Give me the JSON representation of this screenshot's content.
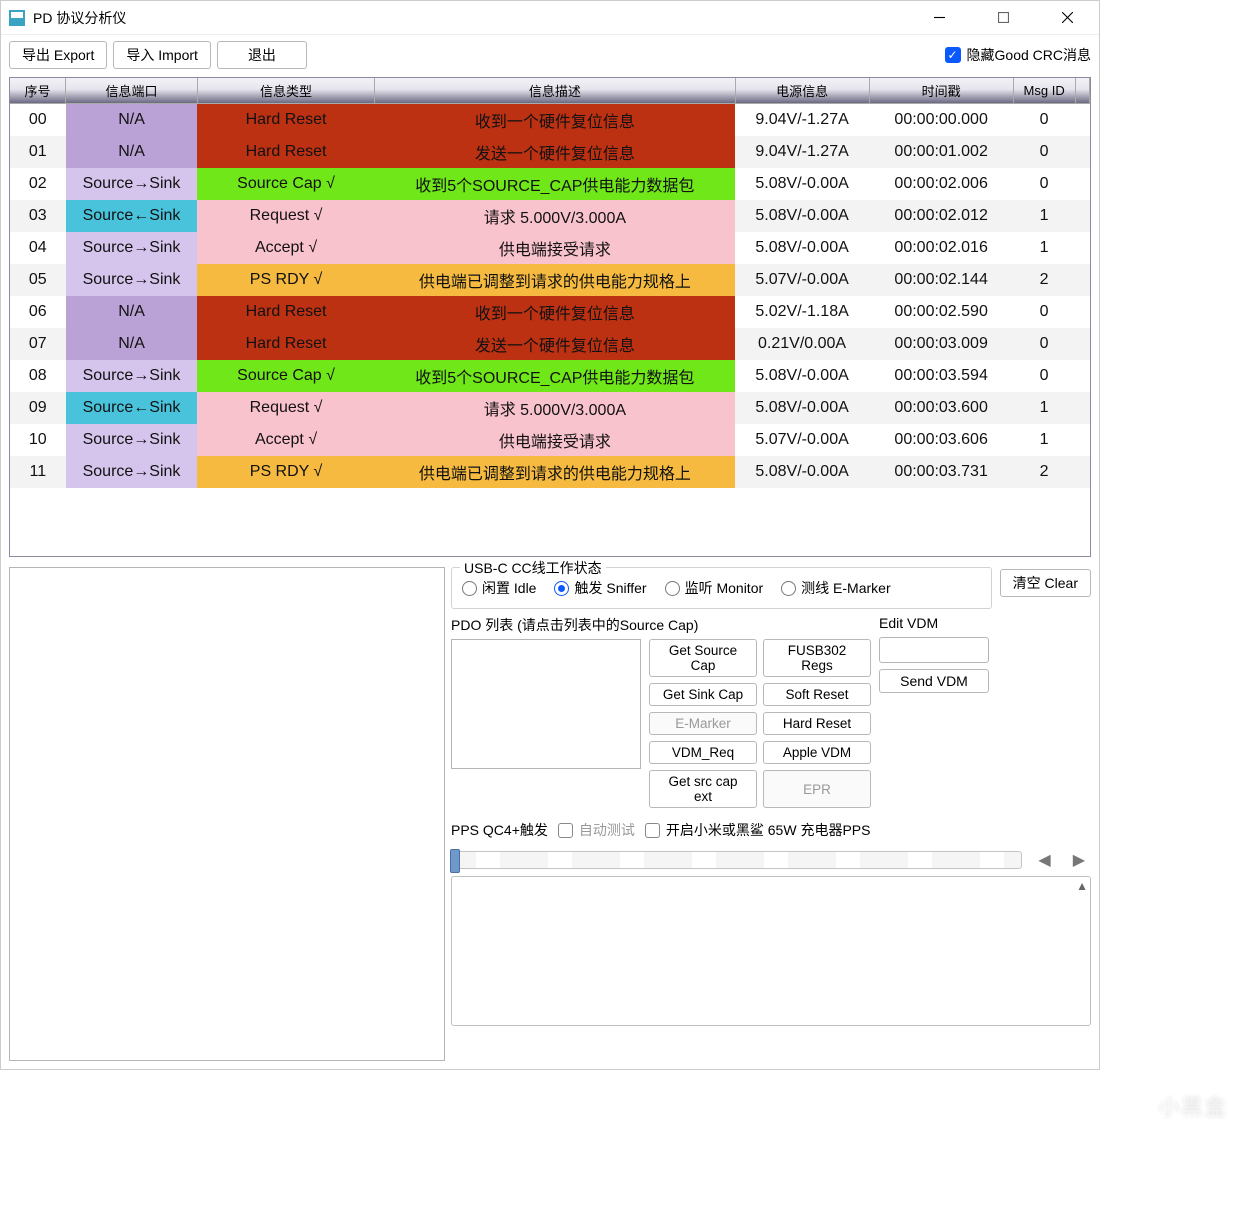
{
  "title": "PD 协议分析仪",
  "toolbar": {
    "export_label": "导出 Export",
    "import_label": "导入 Import",
    "exit_label": "退出",
    "hide_crc_label": "隐藏Good CRC消息"
  },
  "columns": {
    "seq": "序号",
    "port": "信息端口",
    "type": "信息类型",
    "desc": "信息描述",
    "vi": "电源信息",
    "ts": "时间戳",
    "msg": "Msg ID"
  },
  "rows": [
    {
      "seq": "00",
      "port": "N/A",
      "port_cls": "port-na",
      "type": "Hard Reset",
      "type_cls": "type-hard",
      "desc": "收到一个硬件复位信息",
      "desc_cls": "desc-hard",
      "vi": "9.04V/-1.27A",
      "ts": "00:00:00.000",
      "msg": "0"
    },
    {
      "seq": "01",
      "port": "N/A",
      "port_cls": "port-na",
      "type": "Hard Reset",
      "type_cls": "type-hard",
      "desc": "发送一个硬件复位信息",
      "desc_cls": "desc-hard",
      "vi": "9.04V/-1.27A",
      "ts": "00:00:01.002",
      "msg": "0"
    },
    {
      "seq": "02",
      "port": "Source→Sink",
      "port_cls": "port-srcsink",
      "type": "Source Cap √",
      "type_cls": "type-green",
      "desc": "收到5个SOURCE_CAP供电能力数据包",
      "desc_cls": "desc-green",
      "vi": "5.08V/-0.00A",
      "ts": "00:00:02.006",
      "msg": "0"
    },
    {
      "seq": "03",
      "port": "Source←Sink",
      "port_cls": "port-sinksrc",
      "type": "Request √",
      "type_cls": "type-pink",
      "desc": "请求 5.000V/3.000A",
      "desc_cls": "desc-pink",
      "vi": "5.08V/-0.00A",
      "ts": "00:00:02.012",
      "msg": "1"
    },
    {
      "seq": "04",
      "port": "Source→Sink",
      "port_cls": "port-srcsink",
      "type": "Accept √",
      "type_cls": "type-pink",
      "desc": "供电端接受请求",
      "desc_cls": "desc-pink",
      "vi": "5.08V/-0.00A",
      "ts": "00:00:02.016",
      "msg": "1"
    },
    {
      "seq": "05",
      "port": "Source→Sink",
      "port_cls": "port-srcsink",
      "type": "PS RDY √",
      "type_cls": "type-orange",
      "desc": "供电端已调整到请求的供电能力规格上",
      "desc_cls": "desc-orange",
      "vi": "5.07V/-0.00A",
      "ts": "00:00:02.144",
      "msg": "2"
    },
    {
      "seq": "06",
      "port": "N/A",
      "port_cls": "port-na",
      "type": "Hard Reset",
      "type_cls": "type-hard",
      "desc": "收到一个硬件复位信息",
      "desc_cls": "desc-hard",
      "vi": "5.02V/-1.18A",
      "ts": "00:00:02.590",
      "msg": "0"
    },
    {
      "seq": "07",
      "port": "N/A",
      "port_cls": "port-na",
      "type": "Hard Reset",
      "type_cls": "type-hard",
      "desc": "发送一个硬件复位信息",
      "desc_cls": "desc-hard",
      "vi": "0.21V/0.00A",
      "ts": "00:00:03.009",
      "msg": "0"
    },
    {
      "seq": "08",
      "port": "Source→Sink",
      "port_cls": "port-srcsink",
      "type": "Source Cap √",
      "type_cls": "type-green",
      "desc": "收到5个SOURCE_CAP供电能力数据包",
      "desc_cls": "desc-green",
      "vi": "5.08V/-0.00A",
      "ts": "00:00:03.594",
      "msg": "0"
    },
    {
      "seq": "09",
      "port": "Source←Sink",
      "port_cls": "port-sinksrc",
      "type": "Request √",
      "type_cls": "type-pink",
      "desc": "请求 5.000V/3.000A",
      "desc_cls": "desc-pink",
      "vi": "5.08V/-0.00A",
      "ts": "00:00:03.600",
      "msg": "1"
    },
    {
      "seq": "10",
      "port": "Source→Sink",
      "port_cls": "port-srcsink",
      "type": "Accept √",
      "type_cls": "type-pink",
      "desc": "供电端接受请求",
      "desc_cls": "desc-pink",
      "vi": "5.07V/-0.00A",
      "ts": "00:00:03.606",
      "msg": "1"
    },
    {
      "seq": "11",
      "port": "Source→Sink",
      "port_cls": "port-srcsink",
      "type": "PS RDY √",
      "type_cls": "type-orange",
      "desc": "供电端已调整到请求的供电能力规格上",
      "desc_cls": "desc-orange",
      "vi": "5.08V/-0.00A",
      "ts": "00:00:03.731",
      "msg": "2"
    }
  ],
  "cc_group": {
    "legend": "USB-C CC线工作状态",
    "options": [
      "闲置 Idle",
      "触发 Sniffer",
      "监听 Monitor",
      "测线 E-Marker"
    ],
    "selected_index": 1,
    "clear_label": "清空 Clear"
  },
  "pdo": {
    "label": "PDO 列表 (请点击列表中的Source Cap)"
  },
  "buttons": {
    "get_source_cap": "Get Source Cap",
    "fusb302_regs": "FUSB302 Regs",
    "get_sink_cap": "Get Sink Cap",
    "soft_reset": "Soft Reset",
    "e_marker": "E-Marker",
    "hard_reset": "Hard Reset",
    "vdm_req": "VDM_Req",
    "apple_vdm": "Apple VDM",
    "get_src_cap_ext": "Get src cap ext",
    "epr": "EPR"
  },
  "edit_vdm": {
    "label": "Edit VDM",
    "value": "",
    "send_label": "Send VDM"
  },
  "pps": {
    "label": "PPS QC4+触发",
    "auto_test_label": "自动测试",
    "xiaomi_label": "开启小米或黑鲨 65W 充电器PPS"
  },
  "watermark": "小黑盒"
}
